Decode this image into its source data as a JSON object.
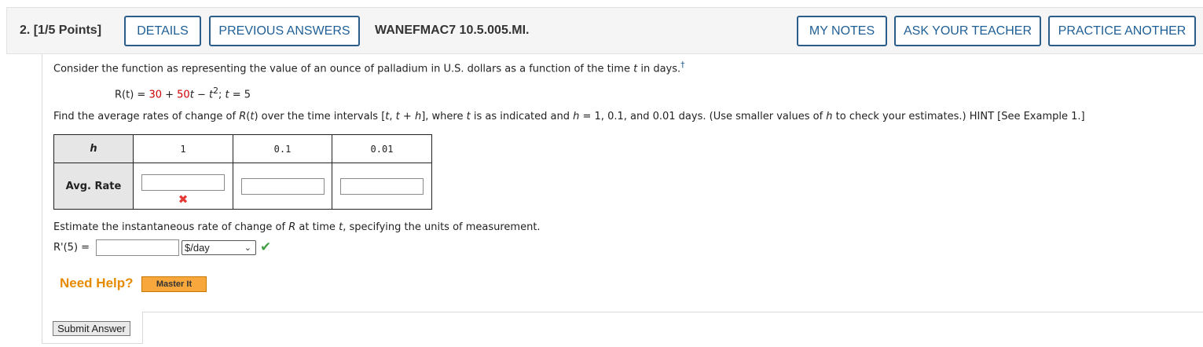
{
  "header": {
    "question_number": "2. [1/5 Points]",
    "details_label": "DETAILS",
    "previous_answers_label": "PREVIOUS ANSWERS",
    "question_code": "WANEFMAC7 10.5.005.MI.",
    "my_notes_label": "MY NOTES",
    "ask_teacher_label": "ASK YOUR TEACHER",
    "practice_another_label": "PRACTICE ANOTHER"
  },
  "question": {
    "intro_before_t": "Consider the function as representing the value of an ounce of palladium in U.S. dollars as a function of the time ",
    "intro_t": "t",
    "intro_after_t": " in days.",
    "dagger": "†",
    "function": {
      "lhs": "R(t) = ",
      "const": "30",
      "plus1": " + ",
      "coef": "50",
      "var_t1": "t",
      "minus": " − ",
      "var_t2": "t",
      "exp": "2",
      "sep": "; ",
      "var_t3": "t",
      "t_value": " = 5"
    },
    "instruction": {
      "p1": "Find the average rates of change of ",
      "p2": "R",
      "p3": "(",
      "p4": "t",
      "p5": ") over the time intervals [",
      "p6": "t",
      "p7": ", ",
      "p8": "t",
      "p9": " + ",
      "p10": "h",
      "p11": "], where ",
      "p12": "t",
      "p13": " is as indicated and ",
      "p14": "h",
      "p15": " = 1, 0.1, and 0.01 days. (Use smaller values of ",
      "p16": "h",
      "p17": " to check your estimates.) HINT [See Example 1.]"
    },
    "table": {
      "header_h": "h",
      "h_values": [
        "1",
        "0.1",
        "0.01"
      ],
      "row_label": "Avg. Rate",
      "answers": [
        "",
        "",
        ""
      ]
    },
    "estimate": {
      "p1": "Estimate the instantaneous rate of change of ",
      "p2": "R",
      "p3": " at time ",
      "p4": "t",
      "p5": ", specifying the units of measurement."
    },
    "rprime_label": "R'(5) = ",
    "rprime_value": "",
    "unit_selected": "$/day",
    "correct_icon": "check-icon",
    "incorrect_icon": "x-icon"
  },
  "help": {
    "need_help_label": "Need Help?",
    "master_it_label": "Master It"
  },
  "submit_label": "Submit Answer",
  "colors": {
    "button_border": "#2a5d8a",
    "button_text": "#1f5f96",
    "red_value": "#cc0000",
    "incorrect": "#e53935",
    "correct": "#43a047",
    "need_help": "#e68a00",
    "master_it_bg": "#f7a73b"
  }
}
